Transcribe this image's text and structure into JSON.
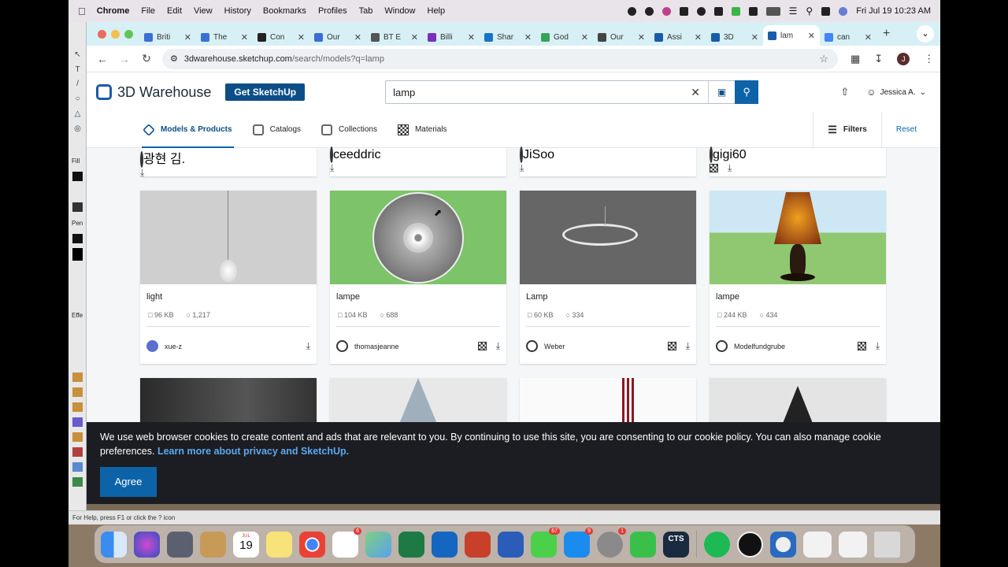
{
  "menubar": {
    "app": "Chrome",
    "items": [
      "File",
      "Edit",
      "View",
      "History",
      "Bookmarks",
      "Profiles",
      "Tab",
      "Window",
      "Help"
    ],
    "clock": "Fri Jul 19  10:23 AM"
  },
  "tabs": [
    {
      "label": "Briti",
      "color": "#3b6fd6"
    },
    {
      "label": "The",
      "color": "#3b6fd6"
    },
    {
      "label": "Con",
      "color": "#222"
    },
    {
      "label": "Our",
      "color": "#3b6fd6"
    },
    {
      "label": "BT E",
      "color": "#555"
    },
    {
      "label": "Billi",
      "color": "#7b2fbf"
    },
    {
      "label": "Shar",
      "color": "#1a73c8"
    },
    {
      "label": "God",
      "color": "#3aa35a"
    },
    {
      "label": "Our",
      "color": "#444"
    },
    {
      "label": "Assi",
      "color": "#1a5ca8"
    },
    {
      "label": "3D",
      "color": "#1a5ca8"
    },
    {
      "label": "lam",
      "color": "#1a5ca8",
      "active": true
    },
    {
      "label": "can",
      "color": "#4285f4"
    }
  ],
  "address": {
    "host": "3dwarehouse.sketchup.com",
    "path": "/search/models?q=lamp",
    "avatar": "J"
  },
  "sketchup_toolbar": {
    "labels": [
      "Fill",
      "Pen",
      "Effe"
    ]
  },
  "site": {
    "logo": "3D Warehouse",
    "get_button": "Get SketchUp",
    "search_value": "lamp",
    "user": "Jessica A.",
    "nav": [
      "Models & Products",
      "Catalogs",
      "Collections",
      "Materials"
    ],
    "filters": "Filters",
    "reset": "Reset"
  },
  "top_row": [
    {
      "author": "광현 김.",
      "materials": false
    },
    {
      "author": "ceeddric",
      "materials": false
    },
    {
      "author": "JiSoo",
      "materials": false
    },
    {
      "author": "gigi60",
      "materials": true
    }
  ],
  "cards": [
    {
      "name": "light",
      "size": "96 KB",
      "views": "1,217",
      "author": "xue-z",
      "avatar": true,
      "materials": false
    },
    {
      "name": "lampe",
      "size": "104 KB",
      "views": "688",
      "author": "thomasjeanne",
      "avatar": false,
      "materials": true
    },
    {
      "name": "Lamp",
      "size": "60 KB",
      "views": "334",
      "author": "Weber",
      "avatar": false,
      "materials": true
    },
    {
      "name": "lampe",
      "size": "244 KB",
      "views": "434",
      "author": "Modelfundgrube",
      "avatar": false,
      "materials": true
    }
  ],
  "cookie": {
    "text": "We use web browser cookies to create content and ads that are relevant to you. By continuing to use this site, you are consenting to our cookie policy. You can also manage cookie preferences.",
    "link": "Learn more about privacy and SketchUp.",
    "agree": "Agree"
  },
  "status_text": "For Help, press F1 or click the ? icon",
  "dock": {
    "calendar_month": "JUL",
    "calendar_day": "19",
    "reminders_badge": "6",
    "messages_badge": "67",
    "appstore_badge": "9",
    "settings_badge": "1",
    "cts_label": "CTS"
  }
}
